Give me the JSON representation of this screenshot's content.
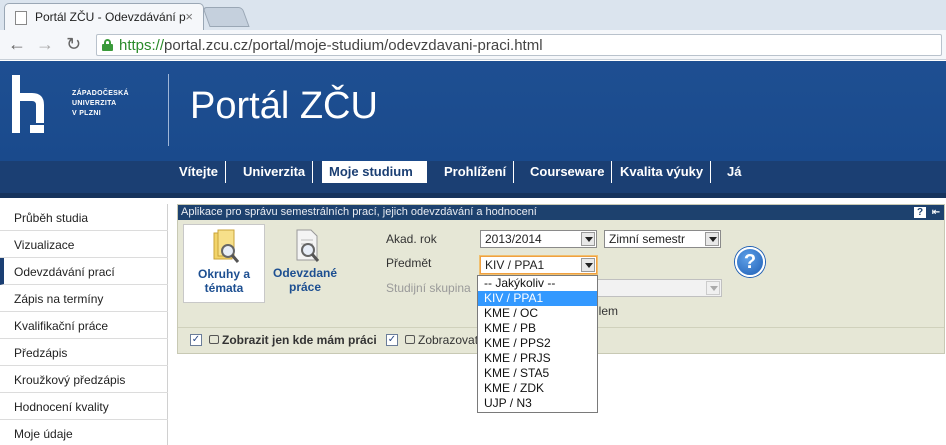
{
  "browser": {
    "tab_title": "Portál ZČU - Odevzdávání p",
    "url_scheme": "https://",
    "url_rest": "portal.zcu.cz/portal/moje-studium/odevzdavani-praci.html"
  },
  "header": {
    "logo_lines": [
      "ZÁPADOČESKÁ",
      "UNIVERZITA",
      "V PLZNI"
    ],
    "title": "Portál ZČU"
  },
  "topnav": [
    "Vítejte",
    "Univerzita",
    "Moje studium",
    "Prohlížení",
    "Courseware",
    "Kvalita výuky",
    "Já"
  ],
  "sidebar": {
    "items": [
      "Průběh studia",
      "Vizualizace",
      "Odevzdávání prací",
      "Zápis na termíny",
      "Kvalifikační práce",
      "Předzápis",
      "Kroužkový předzápis",
      "Hodnocení kvality",
      "Moje údaje"
    ],
    "active": "Odevzdávání prací"
  },
  "panel": {
    "title": "Aplikace pro správu semestrálních prací, jejich odevzdávání a hodnocení",
    "help_small": "?",
    "buttons": [
      {
        "label1": "Okruhy a",
        "label2": "témata"
      },
      {
        "label1": "Odevzdané",
        "label2": "práce"
      }
    ],
    "fields": {
      "akad_rok_label": "Akad. rok",
      "akad_rok_value": "2013/2014",
      "semestr_value": "Zimní semestr",
      "predmet_label": "Předmět",
      "predmet_value": "KIV / PPA1",
      "skupina_label": "Studijní skupina",
      "partial_text": "ilem"
    },
    "help_icon": "?",
    "checkboxes": [
      {
        "label": "Zobrazit jen kde mám práci",
        "checked": "✓"
      },
      {
        "label": "Zobrazovat",
        "checked": "✓"
      }
    ]
  },
  "dropdown": {
    "options": [
      "-- Jakýkoliv --",
      "KIV / PPA1",
      "KME / OC",
      "KME / PB",
      "KME / PPS2",
      "KME / PRJS",
      "KME / STA5",
      "KME / ZDK",
      "UJP / N3"
    ],
    "highlighted": "KIV / PPA1"
  }
}
